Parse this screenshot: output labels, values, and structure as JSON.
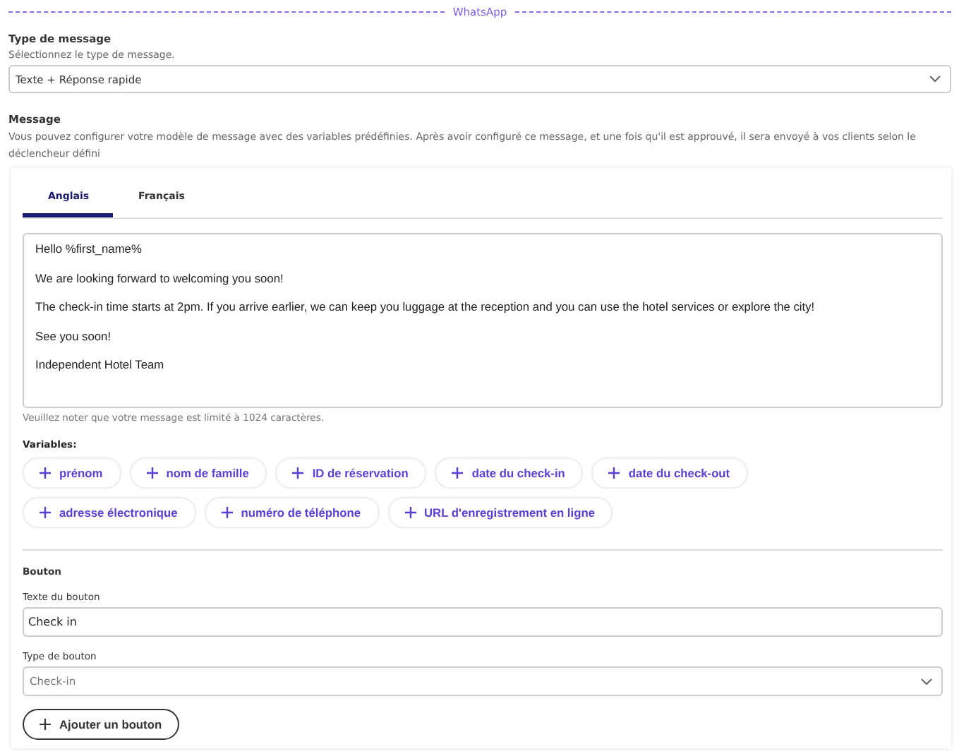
{
  "section_title": "WhatsApp",
  "message_type": {
    "label": "Type de message",
    "hint": "Sélectionnez le type de message.",
    "value": "Texte + Réponse rapide"
  },
  "message": {
    "label": "Message",
    "description": "Vous pouvez configurer votre modèle de message avec des variables prédéfinies. Après avoir configuré ce message, et une fois qu'il est approuvé, il sera envoyé à vos clients selon le déclencheur défini"
  },
  "tabs": [
    {
      "label": "Anglais",
      "selected": true
    },
    {
      "label": "Français",
      "selected": false
    }
  ],
  "body_lines": [
    "Hello %first_name%",
    "We are looking forward to welcoming you soon!",
    "The check-in time starts at 2pm. If you arrive earlier, we can keep you luggage at the reception and you can use the hotel services or explore the city!",
    "See you soon!",
    "Independent Hotel Team"
  ],
  "limit_note": "Veuillez noter que votre message est limité à 1024 caractères.",
  "variables_label": "Variables:",
  "variables": [
    "prénom",
    "nom de famille",
    "ID de réservation",
    "date du check-in",
    "date du check-out",
    "adresse électronique",
    "numéro de téléphone",
    "URL d'enregistrement en ligne"
  ],
  "button_section": {
    "title": "Bouton",
    "text_label": "Texte du bouton",
    "text_value": "Check in",
    "type_label": "Type de bouton",
    "type_value": "Check-in",
    "add_label": "Ajouter un bouton"
  }
}
